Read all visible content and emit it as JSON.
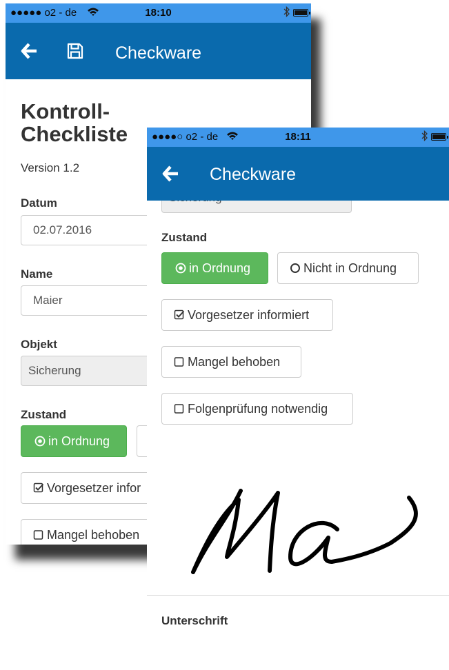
{
  "colors": {
    "statusbar": "#3f97ea",
    "navbar": "#0a6aad",
    "success": "#5cb85c",
    "input_border": "#cccccc",
    "disabled_bg": "#eeeeee"
  },
  "phone1": {
    "status": {
      "carrier": "●●●●● o2 - de",
      "time": "18:10"
    },
    "nav": {
      "title": "Checkware",
      "back_icon": "arrow-left-icon",
      "save_icon": "floppy-disk-icon"
    },
    "heading_line1": "Kontroll-",
    "heading_line2": "Checkliste",
    "version": "Version 1.2",
    "datum": {
      "label": "Datum",
      "value": "02.07.2016"
    },
    "name": {
      "label": "Name",
      "value": "Maier"
    },
    "objekt": {
      "label": "Objekt",
      "value": "Sicherung"
    },
    "zustand": {
      "label": "Zustand",
      "ok": "in Ordnung"
    },
    "vorgesetzter": "Vorgesetzer infor",
    "mangel": "Mangel behoben"
  },
  "phone2": {
    "status": {
      "carrier": "●●●●○ o2 - de",
      "time": "18:11"
    },
    "nav": {
      "title": "Checkware",
      "back_icon": "arrow-left-icon"
    },
    "objekt_partial": "Sicherung",
    "zustand": {
      "label": "Zustand",
      "ok": "in Ordnung",
      "not_ok": "Nicht in Ordnung"
    },
    "vorgesetzter": "Vorgesetzer informiert",
    "mangel": "Mangel behoben",
    "folgepruefung": "Folgenprüfung notwendig",
    "signature_label": "Unterschrift"
  }
}
